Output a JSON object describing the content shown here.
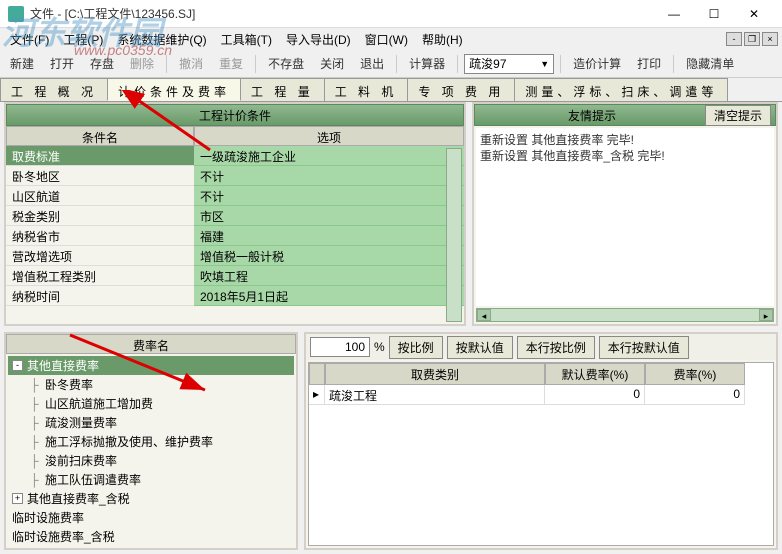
{
  "window": {
    "title": "文件 - [C:\\工程文件\\123456.SJ]"
  },
  "menu": {
    "items": [
      "文件(F)",
      "工程(P)",
      "系统数据维护(Q)",
      "工具箱(T)",
      "导入导出(D)",
      "窗口(W)",
      "帮助(H)"
    ]
  },
  "toolbar": {
    "new": "新建",
    "open": "打开",
    "save": "存盘",
    "delete": "删除",
    "undo": "撤消",
    "redo": "重复",
    "nosave": "不存盘",
    "close": "关闭",
    "exit": "退出",
    "calc": "计算器",
    "combo_value": "疏浚97",
    "cost_calc": "造价计算",
    "print": "打印",
    "hide_list": "隐藏清单"
  },
  "tabs": {
    "items": [
      "工  程  概  况",
      "计价条件及费率",
      "工      程      量",
      "工      料      机",
      "专  项  费  用",
      "测量、浮标、扫床、调遣等"
    ],
    "active_index": 1
  },
  "conditions": {
    "title": "工程计价条件",
    "col1": "条件名",
    "col2": "选项",
    "rows": [
      {
        "name": "取费标准",
        "value": "一级疏浚施工企业",
        "selected": true
      },
      {
        "name": "卧冬地区",
        "value": "不计"
      },
      {
        "name": "山区航道",
        "value": "不计"
      },
      {
        "name": "税金类别",
        "value": "市区"
      },
      {
        "name": "纳税省市",
        "value": "福建"
      },
      {
        "name": "营改增选项",
        "value": "增值税一般计税"
      },
      {
        "name": "增值税工程类别",
        "value": "吹填工程"
      },
      {
        "name": "纳税时间",
        "value": "2018年5月1日起"
      }
    ]
  },
  "tips": {
    "title": "友情提示",
    "clear_btn": "清空提示",
    "lines": [
      "重新设置  其他直接费率  完毕!",
      "重新设置  其他直接费率_含税  完毕!"
    ]
  },
  "rates_tree": {
    "title": "费率名",
    "nodes": [
      {
        "label": "其他直接费率",
        "expand": "-",
        "level": 0,
        "selected": true
      },
      {
        "label": "卧冬费率",
        "level": 1
      },
      {
        "label": "山区航道施工增加费",
        "level": 1
      },
      {
        "label": "疏浚测量费率",
        "level": 1
      },
      {
        "label": "施工浮标抛撤及使用、维护费率",
        "level": 1
      },
      {
        "label": "浚前扫床费率",
        "level": 1
      },
      {
        "label": "施工队伍调遣费率",
        "level": 1
      },
      {
        "label": "其他直接费率_含税",
        "expand": "+",
        "level": 0
      },
      {
        "label": "临时设施费率",
        "level": 0
      },
      {
        "label": "临时设施费率_含税",
        "level": 0
      }
    ]
  },
  "rate_toolbar": {
    "value": "100",
    "pct": "%",
    "btn1": "按比例",
    "btn2": "按默认值",
    "btn3": "本行按比例",
    "btn4": "本行按默认值"
  },
  "rate_grid": {
    "cols": [
      "取费类别",
      "默认费率(%)",
      "费率(%)"
    ],
    "rows": [
      {
        "cat": "疏浚工程",
        "def": "0",
        "rate": "0",
        "marker": "▸"
      }
    ]
  },
  "watermark": {
    "main": "河东软件园",
    "sub": "www.pc0359.cn"
  }
}
